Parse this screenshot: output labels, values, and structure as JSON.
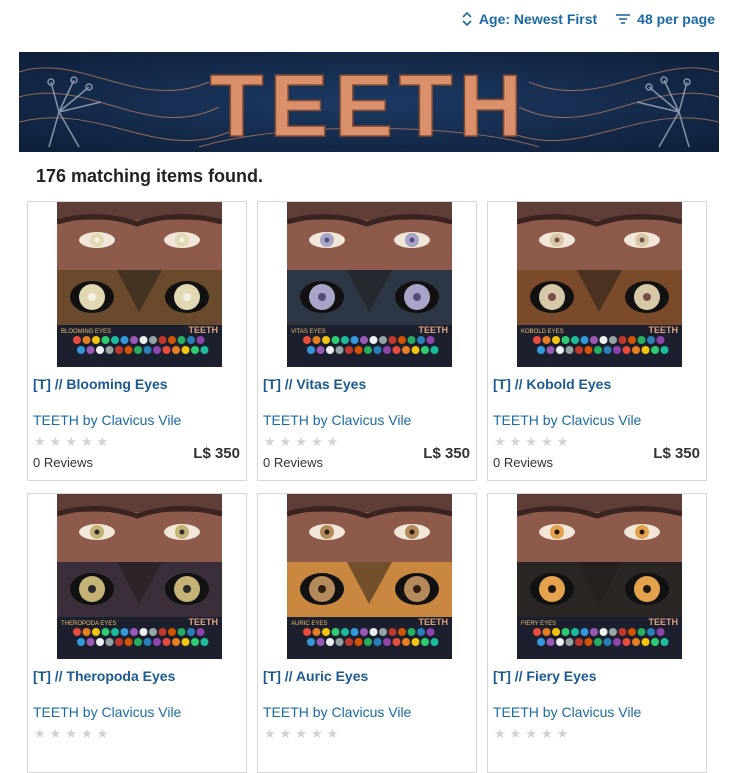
{
  "toolbar": {
    "sort_label": "Age: Newest First",
    "per_page_label": "48 per page"
  },
  "banner": {
    "text": "TEETH"
  },
  "results": {
    "count_text": "176 matching items found."
  },
  "colors": {
    "link": "#1b6aa5",
    "title": "#1b5a92",
    "banner_bg": "#13294a",
    "banner_text": "#d9906b",
    "star_empty": "#d2d2d2"
  },
  "products": [
    {
      "title": "[T] // Blooming Eyes",
      "store": "TEETH by Clavicus Vile",
      "reviews": "0 Reviews",
      "price": "L$ 350",
      "image_label": "BLOOMING EYES",
      "brand_label": "TEETH",
      "iris": "#e2d8b4",
      "pupil": "#f3f0e4",
      "fur": "#6a4a2c"
    },
    {
      "title": "[T] // Vitas Eyes",
      "store": "TEETH by Clavicus Vile",
      "reviews": "0 Reviews",
      "price": "L$ 350",
      "image_label": "VITAS EYES",
      "brand_label": "TEETH",
      "iris": "#a7a6c9",
      "pupil": "#5a4a78",
      "fur": "#2c3644"
    },
    {
      "title": "[T] // Kobold Eyes",
      "store": "TEETH by Clavicus Vile",
      "reviews": "0 Reviews",
      "price": "L$ 350",
      "image_label": "KOBOLD EYES",
      "brand_label": "TEETH",
      "iris": "#d7c8a8",
      "pupil": "#7a4b4b",
      "fur": "#7a4a2a"
    },
    {
      "title": "[T] // Theropoda Eyes",
      "store": "TEETH by Clavicus Vile",
      "reviews": "",
      "price": "",
      "image_label": "THEROPODA EYES",
      "brand_label": "TEETH",
      "iris": "#c4b276",
      "pupil": "#2a2a2a",
      "fur": "#3a2e3a"
    },
    {
      "title": "[T] // Auric Eyes",
      "store": "TEETH by Clavicus Vile",
      "reviews": "",
      "price": "",
      "image_label": "AURIC EYES",
      "brand_label": "TEETH",
      "iris": "#b58a5a",
      "pupil": "#2d1d12",
      "fur": "#c9873f"
    },
    {
      "title": "[T] // Fiery Eyes",
      "store": "TEETH by Clavicus Vile",
      "reviews": "",
      "price": "",
      "image_label": "FIERY EYES",
      "brand_label": "TEETH",
      "iris": "#e4a24c",
      "pupil": "#1f1410",
      "fur": "#2a2624"
    }
  ]
}
